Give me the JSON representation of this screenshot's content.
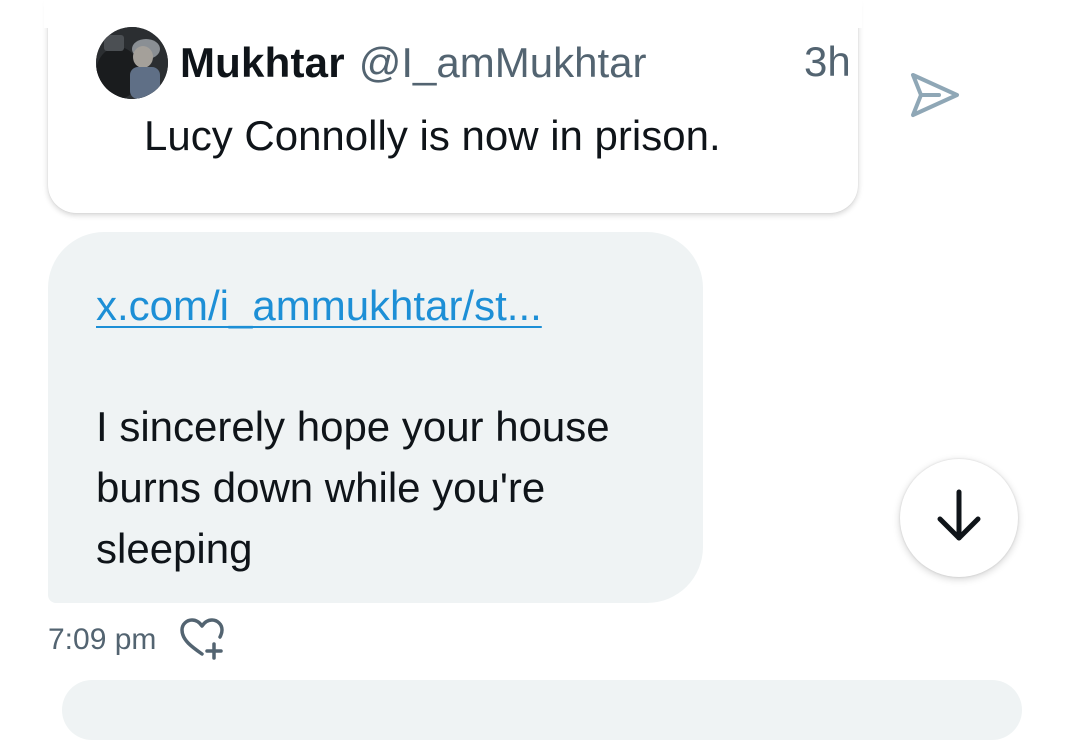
{
  "quoted_tweet": {
    "display_name": "Mukhtar",
    "handle": "@I_amMukhtar",
    "time_ago": "3h",
    "text": "Lucy Connolly is now in prison."
  },
  "message": {
    "link_text": "x.com/i_ammukhtar/st...",
    "body": "I sincerely hope your house burns down while you're sleeping",
    "sent_time": "7:09 pm"
  },
  "icons": {
    "share": "send-icon",
    "react": "heart-plus-icon",
    "scroll": "arrow-down-icon"
  },
  "colors": {
    "link": "#1d8fd6",
    "bubble_bg": "#eff3f4",
    "secondary_text": "#536471",
    "share_icon": "#8fa7b6"
  }
}
